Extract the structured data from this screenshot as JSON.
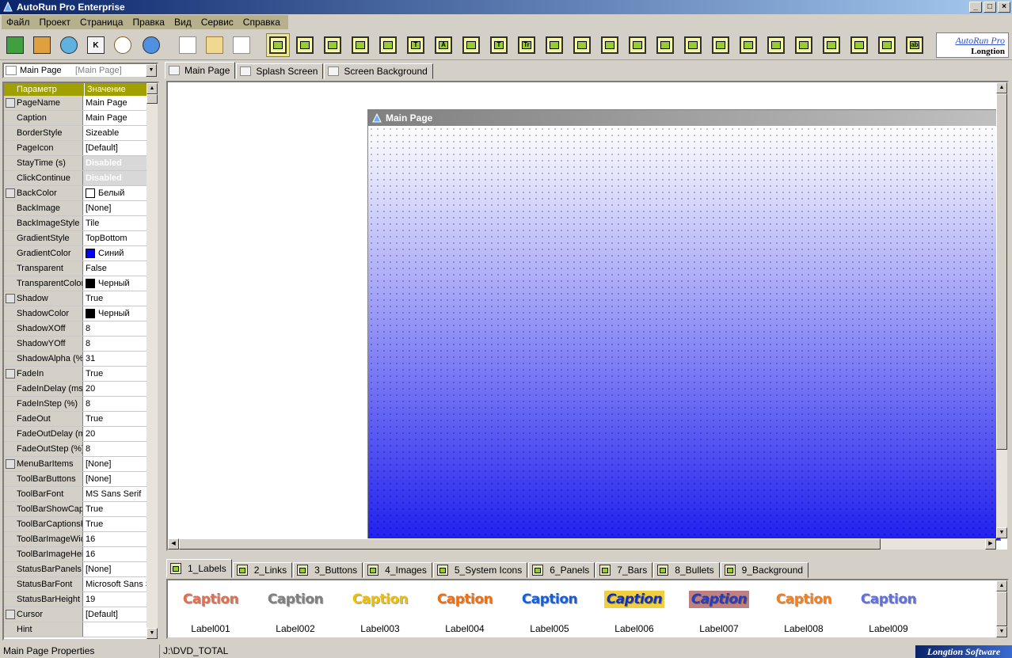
{
  "window": {
    "title": "AutoRun Pro Enterprise",
    "controls": {
      "minimize": "_",
      "maximize": "□",
      "close": "×"
    }
  },
  "menu": [
    "Файл",
    "Проект",
    "Страница",
    "Правка",
    "Вид",
    "Сервис",
    "Справка"
  ],
  "toolbar": {
    "brand_line1": "AutoRun Pro",
    "brand_line2": "Longtion",
    "component_glyphs": [
      "T",
      "A",
      "T",
      "Tr",
      "ab"
    ]
  },
  "left_panel": {
    "page_selector": {
      "value": "Main Page",
      "hint": "[Main Page]"
    },
    "headers": {
      "param": "Параметр",
      "value": "Значение"
    },
    "properties": [
      {
        "name": "PageName",
        "value": "Main Page",
        "icon": "page-name-icon"
      },
      {
        "name": "Caption",
        "value": "Main Page"
      },
      {
        "name": "BorderStyle",
        "value": "Sizeable"
      },
      {
        "name": "PageIcon",
        "value": "[Default]"
      },
      {
        "name": "StayTime (s)",
        "value": "Disabled",
        "disabled": true
      },
      {
        "name": "ClickContinue",
        "value": "Disabled",
        "disabled": true
      },
      {
        "name": "BackColor",
        "value": "Белый",
        "swatch": "#ffffff",
        "icon": "back-color-icon"
      },
      {
        "name": "BackImage",
        "value": "[None]"
      },
      {
        "name": "BackImageStyle",
        "value": "Tile"
      },
      {
        "name": "GradientStyle",
        "value": "TopBottom"
      },
      {
        "name": "GradientColor",
        "value": "Синий",
        "swatch": "#0000ff"
      },
      {
        "name": "Transparent",
        "value": "False"
      },
      {
        "name": "TransparentColor",
        "value": "Черный",
        "swatch": "#000000"
      },
      {
        "name": "Shadow",
        "value": "True",
        "icon": "shadow-icon"
      },
      {
        "name": "ShadowColor",
        "value": "Черный",
        "swatch": "#000000"
      },
      {
        "name": "ShadowXOff",
        "value": "8"
      },
      {
        "name": "ShadowYOff",
        "value": "8"
      },
      {
        "name": "ShadowAlpha (%)",
        "value": "31"
      },
      {
        "name": "FadeIn",
        "value": "True",
        "icon": "fade-icon"
      },
      {
        "name": "FadeInDelay (ms)",
        "value": "20"
      },
      {
        "name": "FadeInStep (%)",
        "value": "8"
      },
      {
        "name": "FadeOut",
        "value": "True"
      },
      {
        "name": "FadeOutDelay (ms)",
        "value": "20"
      },
      {
        "name": "FadeOutStep (%)",
        "value": "8"
      },
      {
        "name": "MenuBarItems",
        "value": "[None]",
        "icon": "menu-bar-icon"
      },
      {
        "name": "ToolBarButtons",
        "value": "[None]"
      },
      {
        "name": "ToolBarFont",
        "value": "MS Sans Serif"
      },
      {
        "name": "ToolBarShowCaptions",
        "value": "True"
      },
      {
        "name": "ToolBarCaptionsRight",
        "value": "True"
      },
      {
        "name": "ToolBarImageWidth",
        "value": "16"
      },
      {
        "name": "ToolBarImageHeight",
        "value": "16"
      },
      {
        "name": "StatusBarPanels",
        "value": "[None]"
      },
      {
        "name": "StatusBarFont",
        "value": "Microsoft Sans Serif"
      },
      {
        "name": "StatusBarHeight",
        "value": "19"
      },
      {
        "name": "Cursor",
        "value": "[Default]",
        "icon": "cursor-icon"
      },
      {
        "name": "Hint",
        "value": ""
      }
    ]
  },
  "page_tabs": [
    "Main Page",
    "Splash Screen",
    "Screen Background"
  ],
  "canvas": {
    "title": "Main Page"
  },
  "component_tabs": [
    "1_Labels",
    "2_Links",
    "3_Buttons",
    "4_Images",
    "5_System Icons",
    "6_Panels",
    "7_Bars",
    "8_Bullets",
    "9_Background"
  ],
  "components": [
    {
      "caption": "Caption",
      "label": "Label001",
      "color": "#e07050"
    },
    {
      "caption": "Caption",
      "label": "Label002",
      "color": "#808080"
    },
    {
      "caption": "Caption",
      "label": "Label003",
      "color": "#f0c000"
    },
    {
      "caption": "Caption",
      "label": "Label004",
      "color": "#f07010"
    },
    {
      "caption": "Caption",
      "label": "Label005",
      "color": "#1060e0"
    },
    {
      "caption": "Caption",
      "label": "Label006",
      "color": "#1030c0"
    },
    {
      "caption": "Caption",
      "label": "Label007",
      "color": "#2040c0"
    },
    {
      "caption": "Caption",
      "label": "Label008",
      "color": "#f08020"
    },
    {
      "caption": "Caption",
      "label": "Label009",
      "color": "#6070e0"
    }
  ],
  "status": {
    "left": "Main Page Properties",
    "path": "J:\\DVD_TOTAL",
    "brand": "Longtion Software"
  }
}
